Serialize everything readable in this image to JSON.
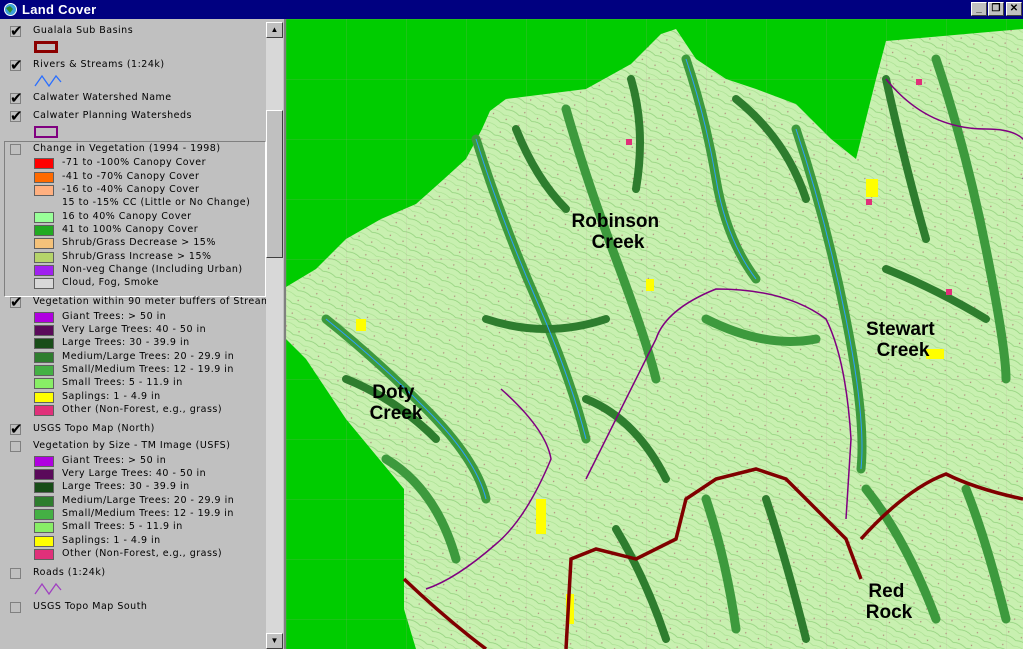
{
  "window": {
    "title": "Land Cover",
    "min": "_",
    "restore": "❐",
    "close": "✕"
  },
  "layers": [
    {
      "id": "gualala",
      "label": "Gualala Sub Basins",
      "checked": true,
      "swatch": "#8b0000"
    },
    {
      "id": "rivers",
      "label": "Rivers & Streams (1:24k)",
      "checked": true
    },
    {
      "id": "calwater_name",
      "label": "Calwater Watershed Name",
      "checked": true
    },
    {
      "id": "calwater_planning",
      "label": "Calwater Planning Watersheds",
      "checked": true,
      "swatch": "#800080"
    },
    {
      "id": "veg_change",
      "label": "Change in Vegetation (1994 - 1998)",
      "checked": false,
      "items": [
        {
          "label": "-71 to -100% Canopy Cover",
          "color": "#ff0000"
        },
        {
          "label": "-41 to -70% Canopy Cover",
          "color": "#ff6a00"
        },
        {
          "label": "-16 to -40% Canopy Cover",
          "color": "#ffb080"
        },
        {
          "label": "15 to -15% CC (Little or No Change)",
          "color": ""
        },
        {
          "label": "16 to 40% Canopy Cover",
          "color": "#99ff99"
        },
        {
          "label": "41 to 100% Canopy Cover",
          "color": "#22aa22"
        },
        {
          "label": "Shrub/Grass Decrease > 15%",
          "color": "#f4c27a"
        },
        {
          "label": "Shrub/Grass Increase > 15%",
          "color": "#b5d46a"
        },
        {
          "label": "Non-veg Change (Including Urban)",
          "color": "#a020f0"
        },
        {
          "label": "Cloud, Fog, Smoke",
          "color": "#d8d8d8"
        }
      ]
    },
    {
      "id": "veg_buffers",
      "label": "Vegetation within 90 meter buffers of Streams",
      "checked": true,
      "items": [
        {
          "label": "Giant Trees: > 50 in",
          "color": "#b000e0"
        },
        {
          "label": "Very Large Trees: 40 - 50 in",
          "color": "#5a0a5a"
        },
        {
          "label": "Large Trees: 30 - 39.9 in",
          "color": "#184d18"
        },
        {
          "label": "Medium/Large Trees: 20 - 29.9 in",
          "color": "#2e7d2e"
        },
        {
          "label": "Small/Medium Trees: 12 - 19.9 in",
          "color": "#44b044"
        },
        {
          "label": "Small Trees: 5 - 11.9 in",
          "color": "#88ee66"
        },
        {
          "label": "Saplings: 1 - 4.9 in",
          "color": "#ffff00"
        },
        {
          "label": "Other (Non-Forest, e.g., grass)",
          "color": "#e0307a"
        }
      ]
    },
    {
      "id": "topo_north",
      "label": "USGS Topo Map (North)",
      "checked": true
    },
    {
      "id": "veg_size",
      "label": "Vegetation by Size - TM Image (USFS)",
      "checked": false,
      "items": [
        {
          "label": "Giant Trees: > 50 in",
          "color": "#b000e0"
        },
        {
          "label": "Very Large Trees: 40 - 50 in",
          "color": "#5a0a5a"
        },
        {
          "label": "Large Trees: 30 - 39.9 in",
          "color": "#184d18"
        },
        {
          "label": "Medium/Large Trees: 20 - 29.9 in",
          "color": "#2e7d2e"
        },
        {
          "label": "Small/Medium Trees: 12 - 19.9 in",
          "color": "#44b044"
        },
        {
          "label": "Small Trees: 5 - 11.9 in",
          "color": "#88ee66"
        },
        {
          "label": "Saplings: 1 - 4.9 in",
          "color": "#ffff00"
        },
        {
          "label": "Other (Non-Forest, e.g., grass)",
          "color": "#e0307a"
        }
      ]
    },
    {
      "id": "roads",
      "label": "Roads (1:24k)",
      "checked": false
    },
    {
      "id": "topo_south",
      "label": "USGS Topo Map South",
      "checked": false
    }
  ],
  "map": {
    "labels": [
      {
        "id": "robinson",
        "lines": [
          "Robinson",
          "Creek"
        ]
      },
      {
        "id": "stewart",
        "lines": [
          "Stewart",
          "Creek"
        ]
      },
      {
        "id": "doty",
        "lines": [
          "Doty",
          "Creek"
        ]
      },
      {
        "id": "redrock",
        "lines": [
          "Red",
          "Rock"
        ]
      }
    ]
  }
}
